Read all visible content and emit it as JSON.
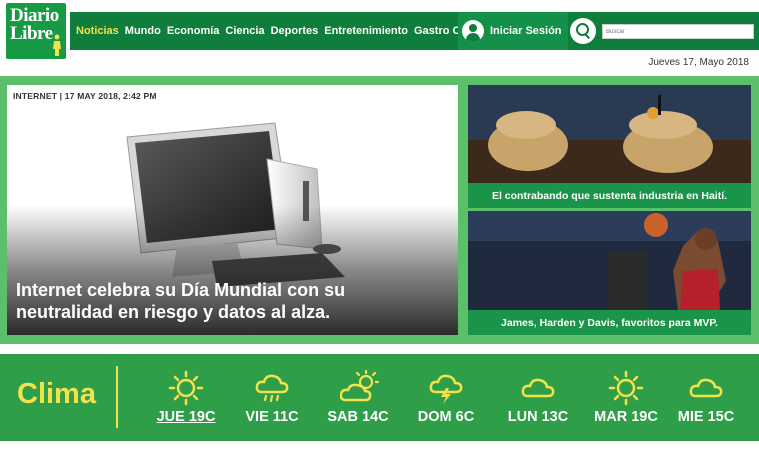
{
  "header": {
    "logo": {
      "line1": "Diario",
      "line2": "Libre"
    },
    "nav": [
      "Noticias",
      "Mundo",
      "Economía",
      "Ciencia",
      "Deportes",
      "Entretenimiento",
      "Gastro Club"
    ],
    "login_label": "Iniciar Sesión",
    "search_placeholder": "Buscar",
    "date": "Jueves 17, Mayo 2018"
  },
  "main_story": {
    "meta": "INTERNET | 17 MAY 2018, 2:42 PM",
    "title": "Internet celebra su Día Mundial con su neutralidad en riesgo y datos al alza."
  },
  "side_stories": [
    {
      "caption": "El contrabando que sustenta industria en Haití."
    },
    {
      "caption": "James, Harden y Davis, favoritos para MVP."
    }
  ],
  "weather": {
    "label": "Clima",
    "days": [
      {
        "label": "JUE 19C",
        "icon": "sun-icon",
        "selected": true
      },
      {
        "label": "VIE 11C",
        "icon": "rain-cloud-icon"
      },
      {
        "label": "SAB 14C",
        "icon": "partly-cloudy-icon"
      },
      {
        "label": "DOM 6C",
        "icon": "storm-cloud-icon"
      },
      {
        "label": "LUN 13C",
        "icon": "cloud-icon"
      },
      {
        "label": "MAR 19C",
        "icon": "sun-icon"
      },
      {
        "label": "MIE 15C",
        "icon": "cloud-icon"
      }
    ]
  },
  "colors": {
    "brand_green": "#0f7d3b",
    "feature_green": "#5cc06a",
    "caption_green": "#1a9448",
    "accent_yellow": "#f3e24c"
  }
}
